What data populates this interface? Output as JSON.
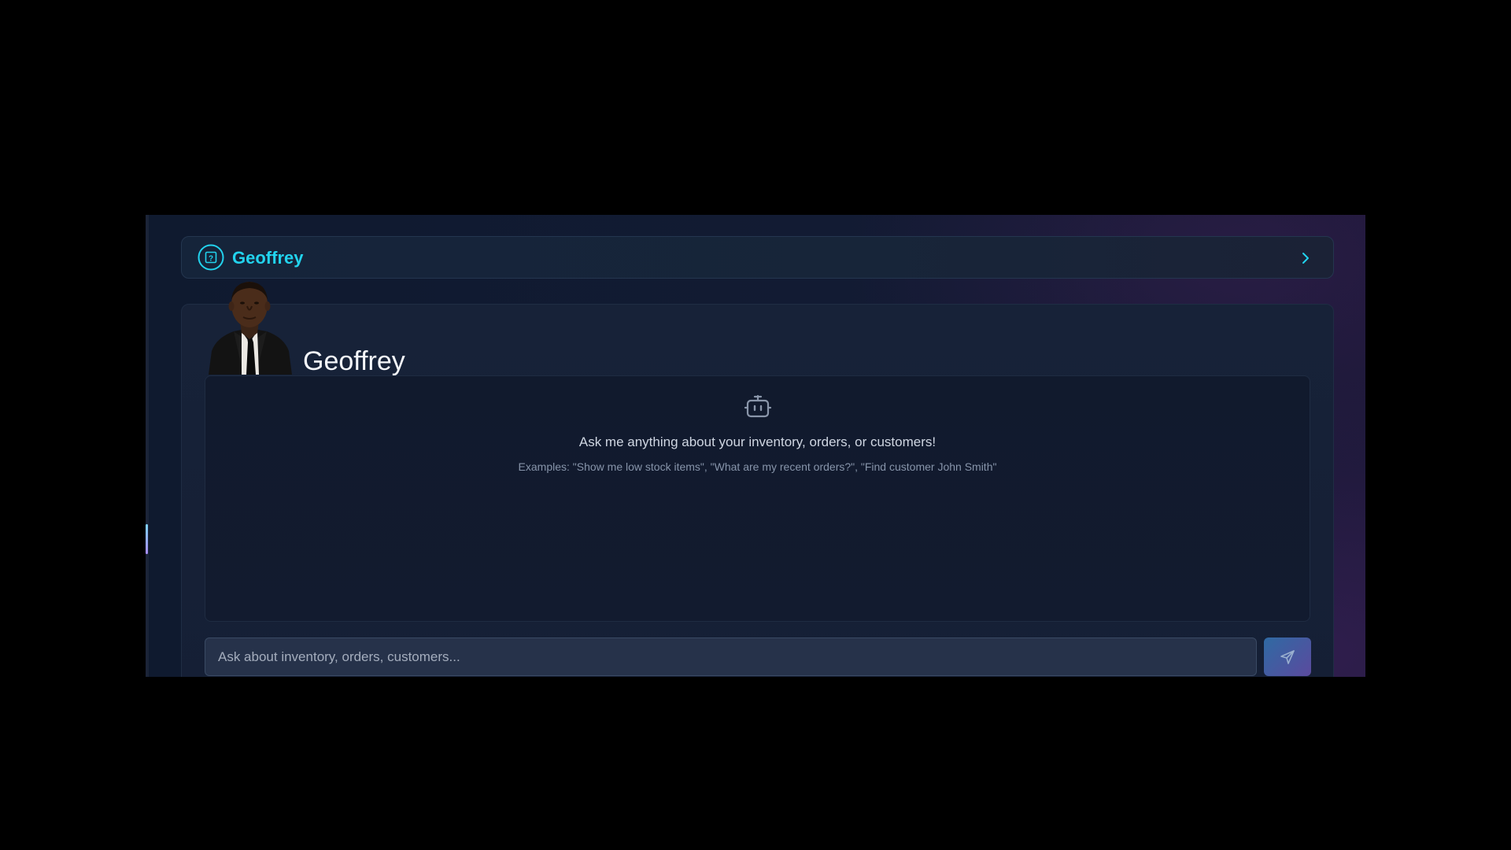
{
  "header": {
    "title": "Geoffrey",
    "logo_icon": "question-square-icon",
    "toggle_icon": "chevron-right-icon"
  },
  "assistant": {
    "name": "Geoffrey",
    "avatar": "portrait-avatar"
  },
  "chat": {
    "empty_icon": "bot-icon",
    "empty_title": "Ask me anything about your inventory, orders, or customers!",
    "empty_examples": "Examples: \"Show me low stock items\", \"What are my recent orders?\", \"Find customer John Smith\""
  },
  "input": {
    "placeholder": "Ask about inventory, orders, customers...",
    "value": ""
  },
  "send": {
    "icon": "send-icon"
  },
  "colors": {
    "accent": "#22d3ee",
    "background": "#121b33",
    "panel": "#172238",
    "text_primary": "#f5f7fb",
    "text_secondary": "#8794aa"
  }
}
